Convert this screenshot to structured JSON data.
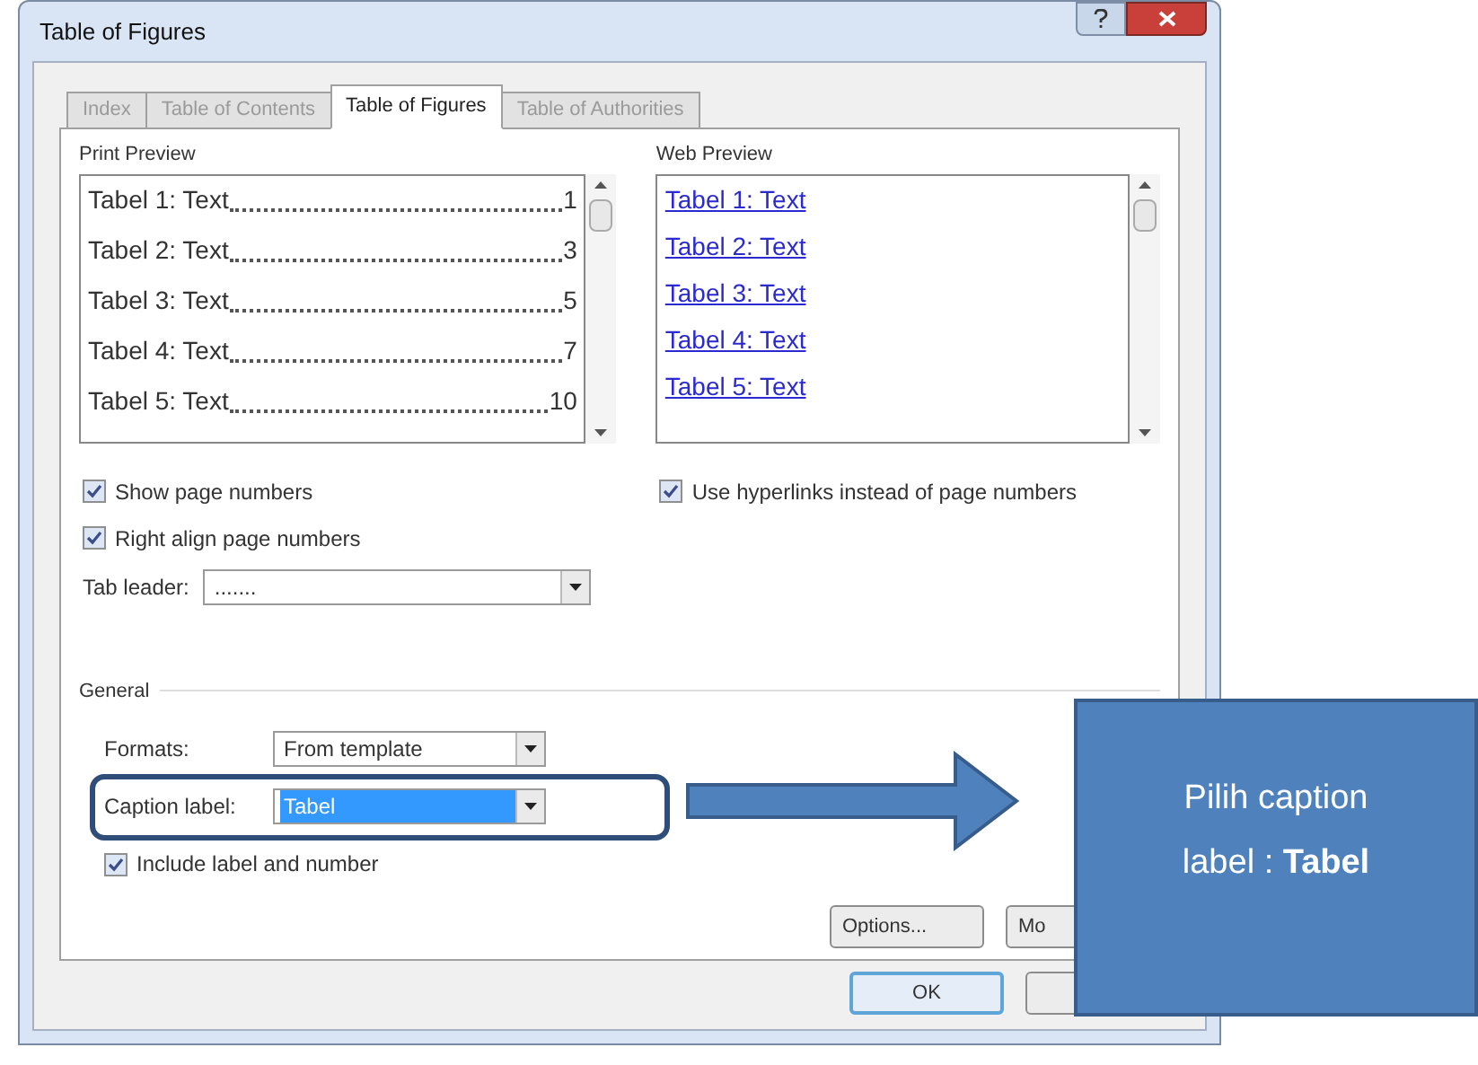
{
  "window": {
    "title": "Table of Figures"
  },
  "tabs": [
    {
      "label": "Index",
      "selected": false
    },
    {
      "label": "Table of Contents",
      "selected": false
    },
    {
      "label": "Table of Figures",
      "selected": true
    },
    {
      "label": "Table of Authorities",
      "selected": false
    }
  ],
  "print_preview": {
    "label": "Print Preview",
    "entries": [
      {
        "text": "Tabel 1: Text",
        "page": "1"
      },
      {
        "text": "Tabel 2: Text",
        "page": "3"
      },
      {
        "text": "Tabel 3: Text",
        "page": "5"
      },
      {
        "text": "Tabel 4: Text",
        "page": "7"
      },
      {
        "text": "Tabel 5: Text",
        "page": "10"
      }
    ]
  },
  "web_preview": {
    "label": "Web Preview",
    "links": [
      "Tabel 1: Text",
      "Tabel 2: Text",
      "Tabel 3: Text",
      "Tabel 4: Text",
      "Tabel 5: Text"
    ]
  },
  "left_checkboxes": [
    {
      "label": "Show page numbers",
      "checked": true
    },
    {
      "label": "Right align page numbers",
      "checked": true
    }
  ],
  "tab_leader": {
    "label": "Tab leader:",
    "value": "......."
  },
  "web_checkbox": {
    "label": "Use hyperlinks instead of page numbers",
    "checked": true
  },
  "general": {
    "label": "General",
    "formats": {
      "label": "Formats:",
      "value": "From template"
    },
    "caption_label": {
      "label": "Caption label:",
      "value": "Tabel",
      "selected": true
    },
    "include": {
      "label": "Include label and number",
      "checked": true
    }
  },
  "buttons": [
    "Options...",
    "Mo"
  ],
  "footer_buttons": [
    "OK"
  ],
  "callout": {
    "text": "Pilih caption label : **Tabel**"
  }
}
